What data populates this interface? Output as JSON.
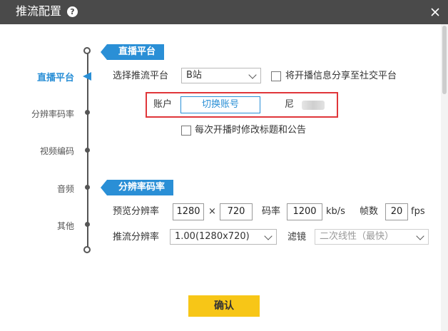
{
  "window": {
    "title": "推流配置",
    "help_icon": "?",
    "close_icon": "close-icon"
  },
  "nav": {
    "items": [
      "直播平台",
      "分辨率码率",
      "视频编码",
      "音频",
      "其他"
    ],
    "active_index": 0
  },
  "platform_section": {
    "heading": "直播平台",
    "select_label": "选择推流平台",
    "platform_value": "B站",
    "share_checkbox_label": "将开播信息分享至社交平台",
    "share_checked": false,
    "account_label": "账户",
    "switch_account_button": "切换账号",
    "account_name": "尼",
    "edit_title_checkbox_label": "每次开播时修改标题和公告",
    "edit_title_checked": false
  },
  "resolution_section": {
    "heading": "分辨率码率",
    "preview_label": "预览分辨率",
    "preview_width": "1280",
    "times_sign": "×",
    "preview_height": "720",
    "bitrate_label": "码率",
    "bitrate_value": "1200",
    "bitrate_unit": "kb/s",
    "fps_label": "帧数",
    "fps_value": "20",
    "fps_unit": "fps",
    "stream_res_label": "推流分辨率",
    "stream_res_value": "1.00(1280x720)",
    "filter_label": "滤镜",
    "filter_value": "二次线性（最快）"
  },
  "footer": {
    "confirm_label": "确认"
  },
  "colors": {
    "titlebar": "#4a4a4a",
    "accent": "#2a8fd6",
    "highlight_border": "#e0363a",
    "confirm_bg": "#f7c617"
  }
}
